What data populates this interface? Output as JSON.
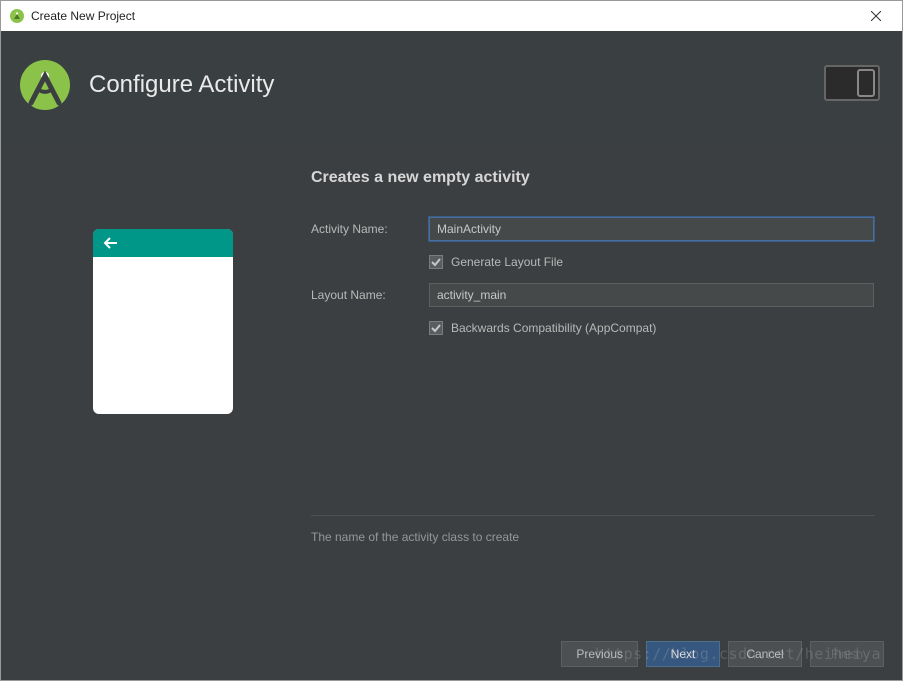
{
  "window": {
    "title": "Create New Project"
  },
  "header": {
    "title": "Configure Activity"
  },
  "content": {
    "section_title": "Creates a new empty activity",
    "activity_name_label": "Activity Name:",
    "activity_name_value": "MainActivity",
    "generate_layout_label": "Generate Layout File",
    "generate_layout_checked": true,
    "layout_name_label": "Layout Name:",
    "layout_name_value": "activity_main",
    "backwards_compat_label": "Backwards Compatibility (AppCompat)",
    "backwards_compat_checked": true,
    "help_text": "The name of the activity class to create"
  },
  "footer": {
    "previous": "Previous",
    "next": "Next",
    "cancel": "Cancel",
    "finish": "Finish"
  },
  "watermark": "https://blog.csdn.net/heiheiya"
}
